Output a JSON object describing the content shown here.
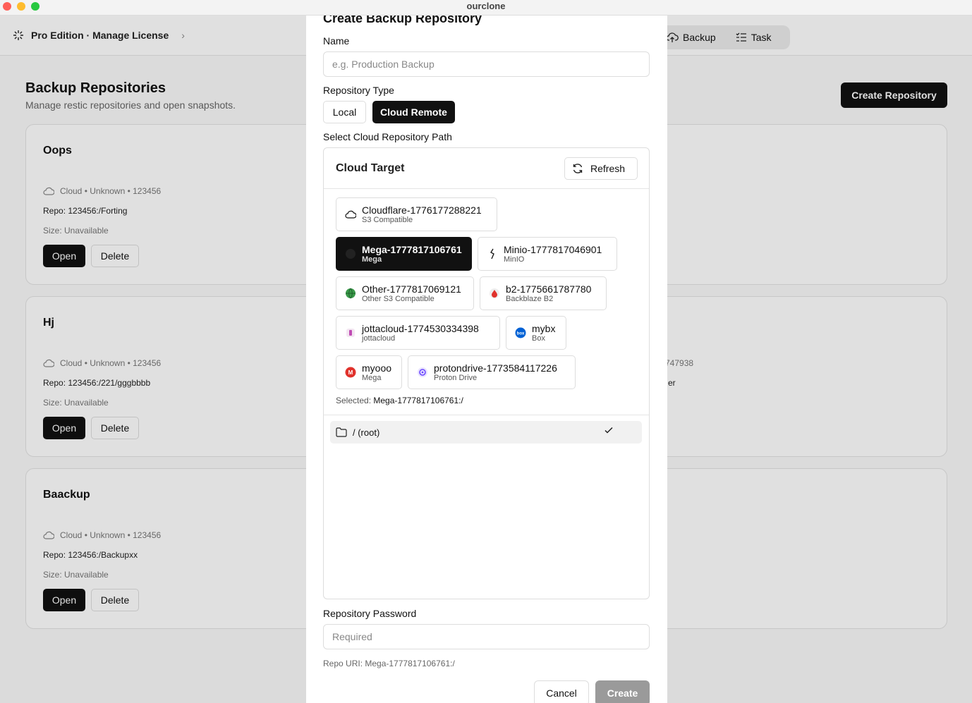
{
  "window": {
    "title": "ourclone"
  },
  "header": {
    "edition": "Pro Edition · Manage License",
    "nav": [
      {
        "label": "Backup",
        "icon": "cloud-upload-icon"
      },
      {
        "label": "Task",
        "icon": "list-check-icon"
      }
    ]
  },
  "page": {
    "title": "Backup Repositories",
    "subtitle": "Manage restic repositories and open snapshots.",
    "create_button": "Create Repository"
  },
  "repos": [
    {
      "name": "Oops",
      "meta": "Cloud • Unknown • 123456",
      "repo": "Repo: 123456:/Forting",
      "size": "Size: Unavailable",
      "right_line1": "",
      "right_line2": ""
    },
    {
      "name": "Hj",
      "meta": "Cloud • Unknown • 123456",
      "repo": "Repo: 123456:/221/gggbbbb",
      "size": "Size: Unavailable",
      "right_line1": "747938",
      "right_line2": "er"
    },
    {
      "name": "Baackup",
      "meta": "Cloud • Unknown • 123456",
      "repo": "Repo: 123456:/Backupxx",
      "size": "Size: Unavailable",
      "right_line1": "",
      "right_line2": ""
    }
  ],
  "card_actions": {
    "open": "Open",
    "delete": "Delete"
  },
  "modal": {
    "title": "Create Backup Repository",
    "name_label": "Name",
    "name_placeholder": "e.g. Production Backup",
    "type_label": "Repository Type",
    "type_local": "Local",
    "type_cloud": "Cloud Remote",
    "path_label": "Select Cloud Repository Path",
    "panel_title": "Cloud Target",
    "refresh": "Refresh",
    "remotes": [
      {
        "name": "Cloudflare-1776177288221",
        "type": "S3 Compatible",
        "icon": "cloud-icon",
        "color": "#111111"
      },
      {
        "name": "Mega-1777817106761",
        "type": "Mega",
        "icon": "mega-icon",
        "color": "#111111"
      },
      {
        "name": "Minio-1777817046901",
        "type": "MinIO",
        "icon": "minio-icon",
        "color": "#111111"
      },
      {
        "name": "Other-1777817069121",
        "type": "Other S3 Compatible",
        "icon": "globe-icon",
        "color": "#3a9a4a"
      },
      {
        "name": "b2-1775661787780",
        "type": "Backblaze B2",
        "icon": "backblaze-icon",
        "color": "#e0322c"
      },
      {
        "name": "jottacloud-1774530334398",
        "type": "jottacloud",
        "icon": "jottacloud-icon",
        "color": "#c04cb4"
      },
      {
        "name": "mybx",
        "type": "Box",
        "icon": "box-icon",
        "color": "#0061d5"
      },
      {
        "name": "myooo",
        "type": "Mega",
        "icon": "mega-icon",
        "color": "#e0322c"
      },
      {
        "name": "protondrive-1773584117226",
        "type": "Proton Drive",
        "icon": "proton-icon",
        "color": "#6d4aff"
      }
    ],
    "selected_prefix": "Selected: ",
    "selected_value": "Mega-1777817106761:/",
    "folder": "/ (root)",
    "password_label": "Repository Password",
    "password_placeholder": "Required",
    "repo_uri": "Repo URI: Mega-1777817106761:/",
    "cancel": "Cancel",
    "create": "Create"
  }
}
